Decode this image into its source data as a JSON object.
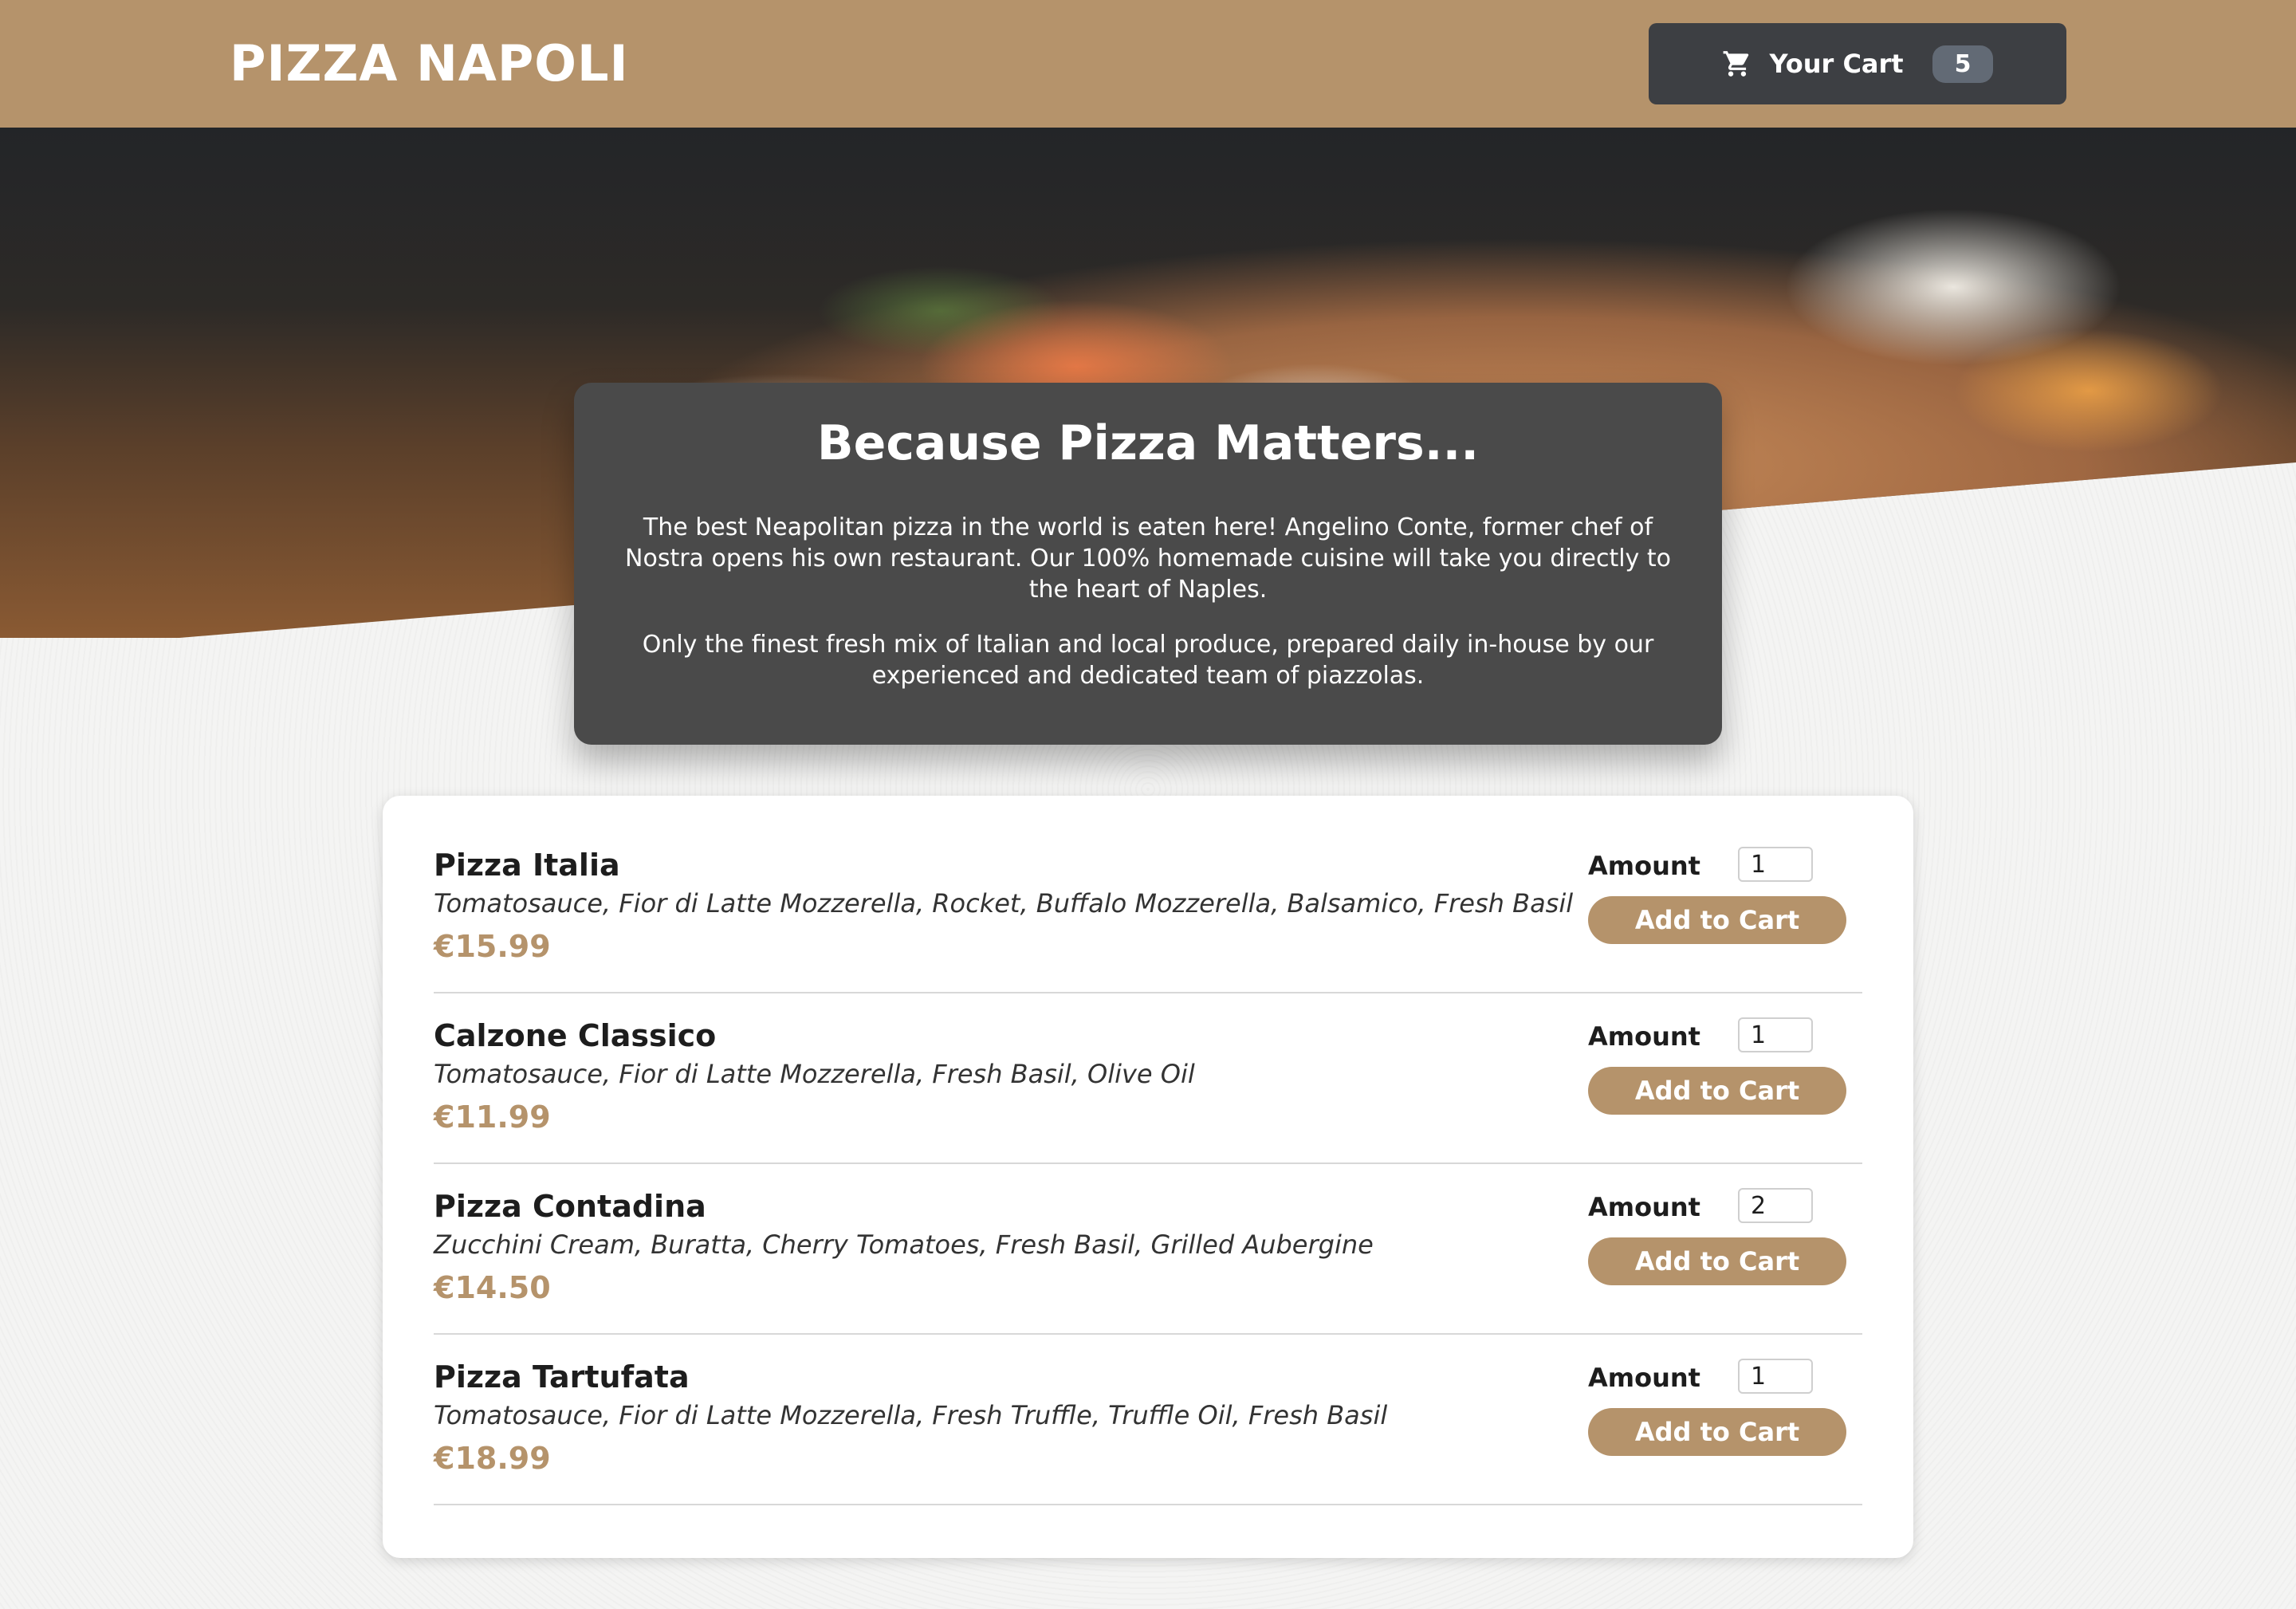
{
  "header": {
    "brand": "PIZZA NAPOLI",
    "cart": {
      "icon": "shopping-cart-icon",
      "label": "Your Cart",
      "count": "5"
    }
  },
  "hero": {
    "image": "pizza-photo"
  },
  "intro": {
    "title": "Because Pizza Matters...",
    "paragraphs": [
      "The best Neapolitan pizza in the world is eaten here! Angelino Conte, former chef of Nostra opens his own restaurant. Our 100% homemade cuisine will take you directly to the heart of Naples.",
      "Only the finest fresh mix of Italian and local produce, prepared daily in-house by our experienced and dedicated team of piazzolas."
    ]
  },
  "menu": {
    "amount_label": "Amount",
    "add_label": "Add to Cart",
    "items": [
      {
        "name": "Pizza Italia",
        "description": "Tomatosauce, Fior di Latte Mozzerella, Rocket, Buffalo Mozzerella, Balsamico, Fresh Basil",
        "price": "€15.99",
        "amount": "1"
      },
      {
        "name": "Calzone Classico",
        "description": "Tomatosauce, Fior di Latte Mozzerella, Fresh Basil, Olive Oil",
        "price": "€11.99",
        "amount": "1"
      },
      {
        "name": "Pizza Contadina",
        "description": "Zucchini Cream, Buratta, Cherry Tomatoes, Fresh Basil, Grilled Aubergine",
        "price": "€14.50",
        "amount": "2"
      },
      {
        "name": "Pizza Tartufata",
        "description": "Tomatosauce, Fior di Latte Mozzerella, Fresh Truffle, Truffle Oil, Fresh Basil",
        "price": "€18.99",
        "amount": "1"
      }
    ]
  },
  "colors": {
    "accent": "#b5936b",
    "dark": "#3d3f43",
    "panel": "#4a4a4a"
  }
}
